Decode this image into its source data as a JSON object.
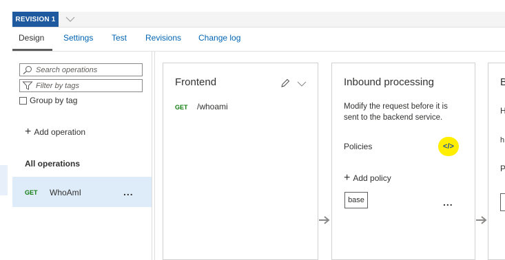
{
  "revision": {
    "badge": "REVISION 1"
  },
  "tabs": [
    {
      "label": "Design",
      "active": true
    },
    {
      "label": "Settings"
    },
    {
      "label": "Test"
    },
    {
      "label": "Revisions"
    },
    {
      "label": "Change log"
    }
  ],
  "left_panel": {
    "search_placeholder": "Search operations",
    "filter_placeholder": "Filter by tags",
    "group_by_tag_label": "Group by tag",
    "group_by_tag_checked": false,
    "add_operation_label": "Add operation",
    "all_operations_label": "All operations",
    "operations": [
      {
        "verb": "GET",
        "name": "WhoAmI",
        "selected": true,
        "more": "..."
      }
    ]
  },
  "frontend": {
    "title": "Frontend",
    "verb": "GET",
    "path": "/whoami"
  },
  "inbound": {
    "title": "Inbound processing",
    "description_line1": "Modify the request before it is",
    "description_line2": "sent to the backend service.",
    "policies_label": "Policies",
    "code_editor_glyph": "</>",
    "add_policy_label": "Add policy",
    "base_label": "base",
    "more": "..."
  },
  "backend_partial": {
    "title": "B",
    "line1": "H",
    "line2": "h",
    "line3": "P"
  },
  "colors": {
    "brand_blue": "#1f5aa0",
    "link_blue": "#0063b1",
    "get_green": "#107c10",
    "selected_row": "#deecf9",
    "highlight_yellow": "#ffee00"
  }
}
